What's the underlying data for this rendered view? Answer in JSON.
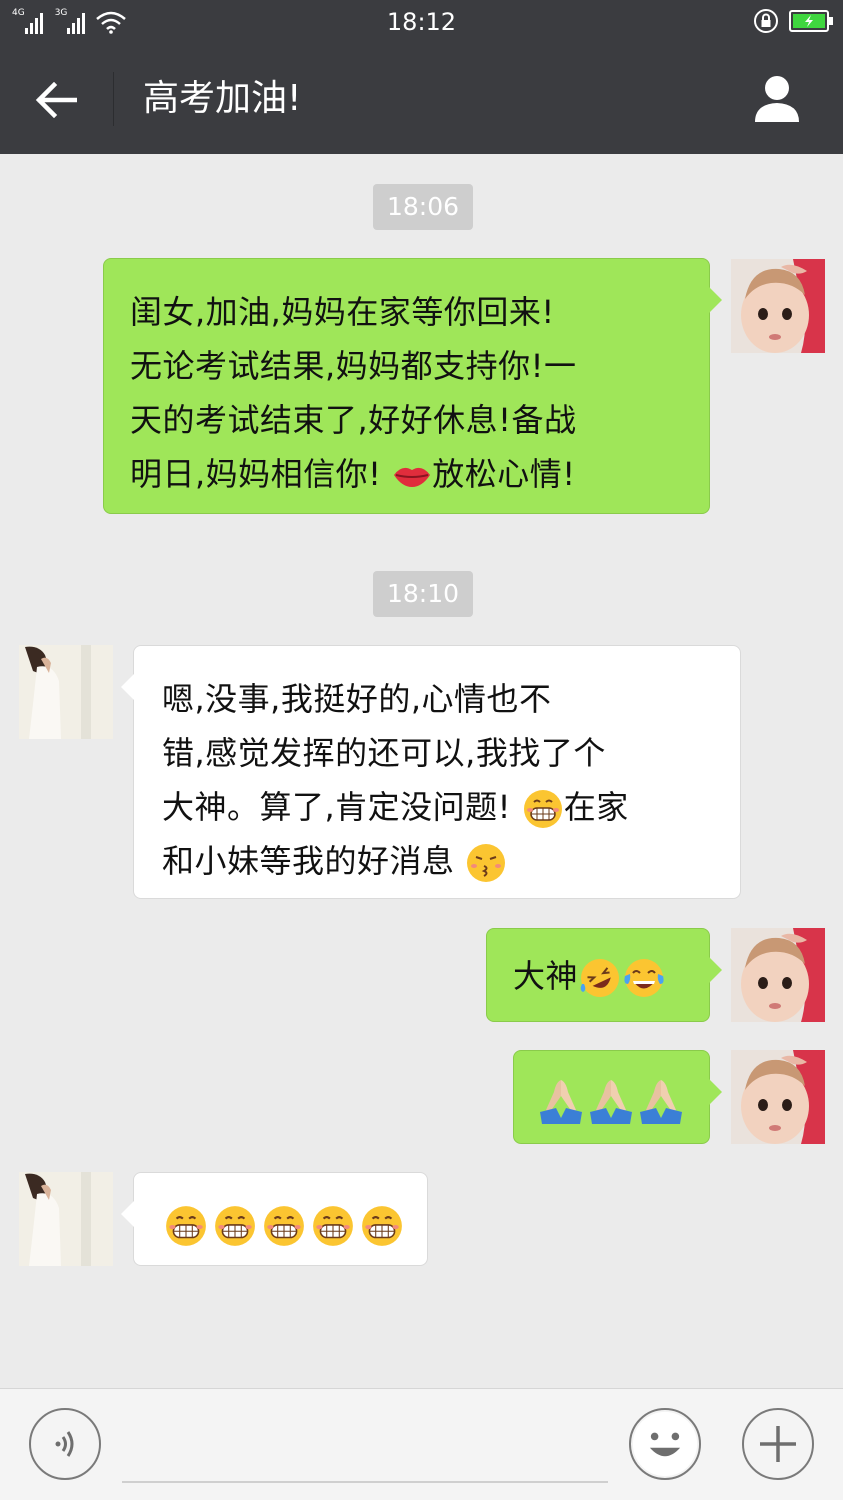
{
  "status_bar": {
    "network_1": "4G",
    "network_2": "3G",
    "time": "18:12",
    "battery_color": "#3fd63f"
  },
  "header": {
    "title": "高考加油!",
    "back_icon": "arrow-left-icon",
    "profile_icon": "person-icon"
  },
  "messages": [
    {
      "type": "timestamp",
      "text": "18:06"
    },
    {
      "type": "sent",
      "lines": [
        "闺女,加油,妈妈在家等你回来!",
        "无论考试结果,妈妈都支持你!一",
        "天的考试结束了,好好休息!备战",
        "明日,妈妈相信你!"
      ],
      "trailing_emoji": "lips",
      "trailing_text": "放松心情!"
    },
    {
      "type": "timestamp",
      "text": "18:10"
    },
    {
      "type": "received",
      "lines": [
        "嗯,没事,我挺好的,心情也不",
        "错,感觉发挥的还可以,我找了个",
        "大神。算了,肯定没问题!",
        "和小妹等我的好消息"
      ],
      "line3_emoji": "grin",
      "line3_tail": "在家",
      "line4_emoji": "kiss"
    },
    {
      "type": "sent",
      "text": "大神",
      "emojis": [
        "rofl",
        "joy"
      ]
    },
    {
      "type": "sent",
      "emojis": [
        "pray",
        "pray",
        "pray"
      ]
    },
    {
      "type": "received",
      "emojis": [
        "grin",
        "grin",
        "grin",
        "grin",
        "grin"
      ]
    }
  ],
  "input_bar": {
    "voice_icon": "voice-icon",
    "emoji_icon": "smiley-icon",
    "plus_icon": "plus-icon"
  },
  "colors": {
    "sent_bubble": "#9fe659",
    "received_bubble": "#ffffff",
    "header_bg": "#3b3c40",
    "chat_bg": "#ebebeb"
  }
}
